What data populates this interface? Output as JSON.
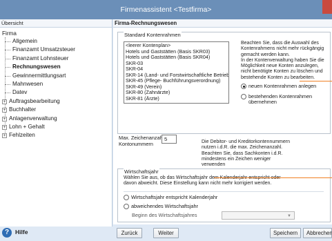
{
  "window": {
    "title": "Firmenassistent <Testfirma>"
  },
  "sidebar": {
    "header": "Übersicht",
    "root": "Firma",
    "items": [
      {
        "label": "Allgemein",
        "type": "leaf"
      },
      {
        "label": "Finanzamt Umsatzsteuer",
        "type": "leaf"
      },
      {
        "label": "Finanzamt Lohnsteuer",
        "type": "leaf"
      },
      {
        "label": "Rechnungswesen",
        "type": "leaf",
        "selected": true
      },
      {
        "label": "Gewinnermittlungsart",
        "type": "leaf"
      },
      {
        "label": "Mahnwesen",
        "type": "leaf"
      },
      {
        "label": "Datev",
        "type": "leaf"
      },
      {
        "label": "Auftragsbearbeitung",
        "type": "expandable"
      },
      {
        "label": "Buchhalter",
        "type": "expandable"
      },
      {
        "label": "Anlagenverwaltung",
        "type": "expandable"
      },
      {
        "label": "Lohn + Gehalt",
        "type": "expandable"
      },
      {
        "label": "Fehlzeiten",
        "type": "expandable"
      }
    ],
    "help_label": "Hilfe"
  },
  "main": {
    "header": "Firma-Rechnungswesen",
    "kontenrahmen": {
      "label": "Standard Kontenrahmen",
      "options": [
        "<leerer Kontenplan>",
        "Hotels und Gaststätten (Basis SKR03)",
        "Hotels und Gaststätten (Basis SKR04)",
        "SKR-03",
        "SKR-04",
        "SKR-14 (Land- und Forstwirtschaftliche Betriebe",
        "SKR-45 (Pflege- Buchführungsverordnung)",
        "SKR-49 (Verein)",
        "SKR-80 (Zahnärzte)",
        "SKR-81 (Ärzte)"
      ],
      "note_lines": [
        "Beachten Sie, dass die Auswahl des",
        "Kontenrahmens nicht mehr rückgängig",
        "gemacht werden kann.",
        "In der Kontenverwaltung haben Sie die",
        "Möglichkeit neue Konten anzulegen,",
        "nicht benötigte Konten zu löschen und",
        "bestehende Konten zu bearbeiten."
      ],
      "radio_new": "neuen Kontenrahmen anlegen",
      "radio_existing_lines": [
        "bestehenden Kontenrahmen",
        "übernehmen"
      ]
    },
    "zeichen": {
      "label_lines": [
        "Max. Zeichenanzahl der",
        "Kontonummern"
      ],
      "value": "5",
      "note_lines": [
        "Die Debitor- und Kreditorkontennummern",
        "nutzen i.d.R. die max. Zeichenanzahl.",
        "Beachten Sie, dass Sachkonten i.d.R.",
        "mindestens ein Zeichen weniger",
        "verwenden"
      ]
    },
    "wirtschaftsjahr": {
      "label": "Wirtschaftsjahr",
      "desc_lines": [
        "Wählen Sie aus, ob das Wirtschaftsjahr dem Kalenderjahr entspricht oder",
        "davon abweicht. Diese Einstellung kann nicht mehr korrigiert werden."
      ],
      "radio_kalender": "Wirtschaftsjahr entspricht Kalenderjahr",
      "radio_abweichend": "abweichendes Wirtschaftsjahr",
      "beginn_label": "Beginn des Wirtschaftsjahres"
    }
  },
  "buttons": {
    "back": "Zurück",
    "next": "Weiter",
    "save": "Speichern",
    "cancel": "Abbrechen"
  },
  "colors": {
    "titlebar": "#6b8fb8",
    "accent_callout": "#f07f22",
    "help_icon": "#2f6db4"
  }
}
